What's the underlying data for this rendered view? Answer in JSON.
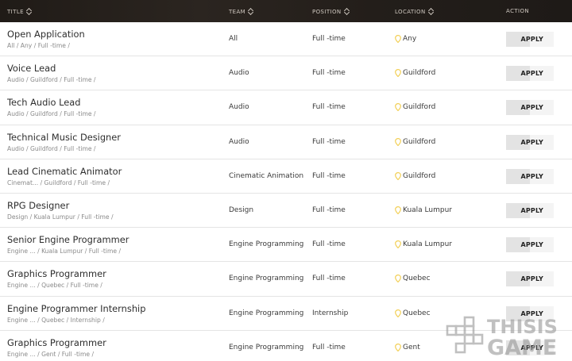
{
  "header": {
    "columns": [
      "TITLE",
      "TEAM",
      "POSITION",
      "LOCATION",
      "ACTION"
    ]
  },
  "jobs": [
    {
      "title": "Open Application",
      "meta": "All / Any / Full -time /",
      "team": "All",
      "position": "Full -time",
      "location": "Any",
      "action": "APPLY"
    },
    {
      "title": "Voice Lead",
      "meta": "Audio / Guildford / Full -time /",
      "team": "Audio",
      "position": "Full -time",
      "location": "Guildford",
      "action": "APPLY"
    },
    {
      "title": "Tech Audio Lead",
      "meta": "Audio / Guildford / Full -time /",
      "team": "Audio",
      "position": "Full -time",
      "location": "Guildford",
      "action": "APPLY"
    },
    {
      "title": "Technical Music Designer",
      "meta": "Audio / Guildford / Full -time /",
      "team": "Audio",
      "position": "Full -time",
      "location": "Guildford",
      "action": "APPLY"
    },
    {
      "title": "Lead Cinematic Animator",
      "meta": "Cinemat... / Guildford / Full -time /",
      "team": "Cinematic Animation",
      "position": "Full -time",
      "location": "Guildford",
      "action": "APPLY"
    },
    {
      "title": "RPG Designer",
      "meta": "Design / Kuala Lumpur / Full -time /",
      "team": "Design",
      "position": "Full -time",
      "location": "Kuala Lumpur",
      "action": "APPLY"
    },
    {
      "title": "Senior Engine Programmer",
      "meta": "Engine ... / Kuala Lumpur / Full -time /",
      "team": "Engine Programming",
      "position": "Full -time",
      "location": "Kuala Lumpur",
      "action": "APPLY"
    },
    {
      "title": "Graphics Programmer",
      "meta": "Engine ... / Quebec / Full -time /",
      "team": "Engine Programming",
      "position": "Full -time",
      "location": "Quebec",
      "action": "APPLY"
    },
    {
      "title": "Engine Programmer Internship",
      "meta": "Engine ... / Quebec / Internship /",
      "team": "Engine Programming",
      "position": "Internship",
      "location": "Quebec",
      "action": "APPLY"
    },
    {
      "title": "Graphics Programmer",
      "meta": "Engine ... / Gent / Full -time /",
      "team": "Engine Programming",
      "position": "Full -time",
      "location": "Gent",
      "action": "APPLY"
    }
  ],
  "watermark": {
    "line1": "THISIS",
    "line2": "GAME"
  },
  "icons": {
    "sort": "sort-updown-icon",
    "location": "map-pin-icon"
  },
  "colors": {
    "header_bg": "#231e1a",
    "pin": "#f2cf55",
    "apply_bg": "#e3e3e3"
  }
}
